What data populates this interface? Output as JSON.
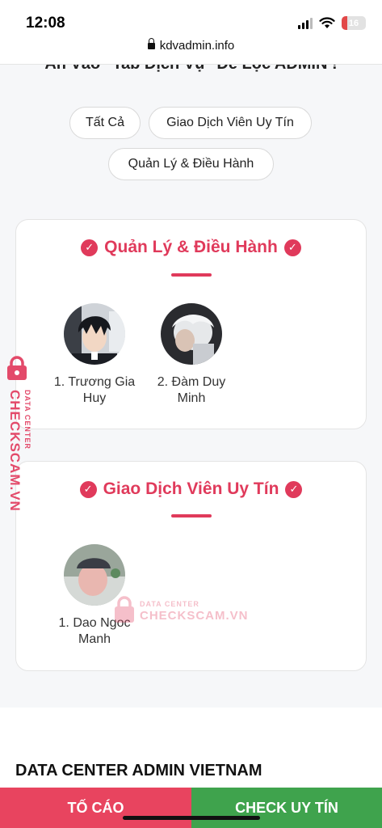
{
  "status_bar": {
    "time": "12:08",
    "battery": "16",
    "url": "kdvadmin.info"
  },
  "icons": {
    "signal": "signal-icon",
    "wifi": "wifi-icon",
    "battery": "battery-icon",
    "lock": "lock-icon",
    "check": "check-circle-icon"
  },
  "heading_cut": "Ấn Vào \"Tab Dịch Vụ\" Để Lọc ADMIN !",
  "filters": {
    "all": "Tất Cả",
    "trusted": "Giao Dịch Viên Uy Tín",
    "management": "Quản Lý & Điều Hành"
  },
  "sections": [
    {
      "title": "Quản Lý & Điều Hành",
      "members": [
        {
          "name": "1. Trương Gia Huy"
        },
        {
          "name": "2. Đàm Duy Minh"
        }
      ]
    },
    {
      "title": "Giao Dịch Viên Uy Tín",
      "members": [
        {
          "name": "1. Dao Ngoc Manh"
        }
      ]
    }
  ],
  "watermark": {
    "brand": "CHECKSCAM.VN",
    "sub": "DATA CENTER"
  },
  "footer": {
    "title": "DATA CENTER ADMIN VIETNAM",
    "report": "TỐ CÁO",
    "check": "CHECK UY TÍN"
  },
  "colors": {
    "accent": "#e03a5b",
    "report": "#e8445f",
    "check": "#3fa34d"
  }
}
